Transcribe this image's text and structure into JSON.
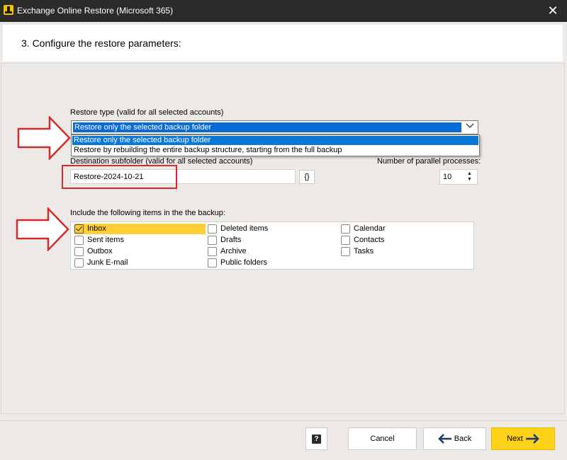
{
  "window": {
    "title": "Exchange Online Restore (Microsoft 365)",
    "close_glyph": "✕"
  },
  "header": {
    "step_title": "3. Configure the restore parameters:"
  },
  "restore_type": {
    "label": "Restore type (valid for all selected accounts)",
    "selected": "Restore only the selected backup folder",
    "options": [
      "Restore only the selected backup folder",
      "Restore by rebuilding the entire backup structure, starting from the full backup"
    ]
  },
  "destination": {
    "label": "Destination subfolder (valid for all selected accounts)",
    "value": "Restore-2024-10-21",
    "variables_button": "{}"
  },
  "parallel": {
    "label": "Number of parallel processes:",
    "value": "10"
  },
  "items": {
    "label": "Include the following items in the the backup:",
    "list": [
      {
        "label": "Inbox",
        "checked": true
      },
      {
        "label": "Sent items",
        "checked": false
      },
      {
        "label": "Outbox",
        "checked": false
      },
      {
        "label": "Junk E-mail",
        "checked": false
      },
      {
        "label": "Deleted items",
        "checked": false
      },
      {
        "label": "Drafts",
        "checked": false
      },
      {
        "label": "Archive",
        "checked": false
      },
      {
        "label": "Public folders",
        "checked": false
      },
      {
        "label": "Calendar",
        "checked": false
      },
      {
        "label": "Contacts",
        "checked": false
      },
      {
        "label": "Tasks",
        "checked": false
      }
    ]
  },
  "footer": {
    "help_label": "?",
    "cancel_label": "Cancel",
    "back_label": "Back",
    "next_label": "Next"
  },
  "colors": {
    "accent_yellow": "#ffd21a",
    "selection_blue": "#0a78d7",
    "annotation_red": "#d32b2b",
    "titlebar": "#2b2b2b"
  },
  "icons": [
    "app-logo-icon",
    "close-icon",
    "chevron-down-icon",
    "spin-up-icon",
    "spin-down-icon",
    "checkmark-icon",
    "help-icon",
    "arrow-left-icon",
    "arrow-right-icon"
  ]
}
